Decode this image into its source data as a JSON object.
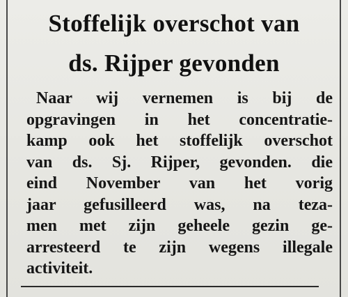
{
  "headline": {
    "line1": "Stoffelijk overschot van",
    "line2": "ds. Rijper gevonden"
  },
  "body": {
    "lines": [
      "Naar wij  vernemen is bij de",
      "opgravingen in het concentratie-",
      "kamp ook het stoffelijk overschot",
      "van ds. Sj. Rijper, gevonden. die",
      "eind November  van het vorig",
      "jaar gefusilleerd was, na teza-",
      "men met zijn geheele gezin ge-",
      "arresteerd te zijn wegens illegale",
      "activiteit."
    ]
  }
}
